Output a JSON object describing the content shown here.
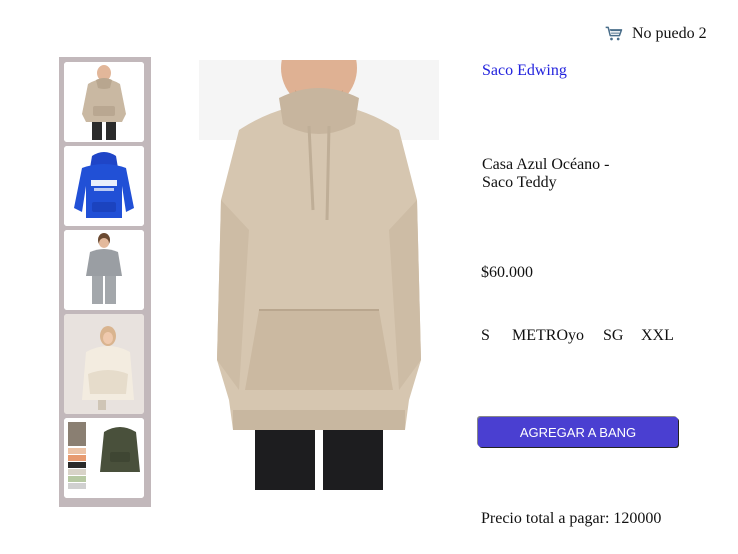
{
  "cart": {
    "icon": "cart-icon",
    "label": "No puedo 2"
  },
  "gallery": {
    "thumbnails": [
      {
        "name": "thumbnail-beige-hoodie"
      },
      {
        "name": "thumbnail-blue-hoodie"
      },
      {
        "name": "thumbnail-gray-sweatsuit"
      },
      {
        "name": "thumbnail-blanket-hoodie"
      },
      {
        "name": "thumbnail-hoodie-stack"
      }
    ],
    "main_image": "beige-hoodie-photo"
  },
  "product": {
    "link_title": "Saco Edwing",
    "description": "Casa Azul Océano - Saco Teddy",
    "price": "$60.000",
    "sizes": [
      "S",
      "METROyo",
      "SG",
      "XXL"
    ],
    "add_button": "AGREGAR A BANG",
    "total_label": "Precio total a pagar: 120000"
  },
  "colors": {
    "accent": "#4a3fd1",
    "link": "#2222dd",
    "thumb_bg": "#c2b8bb"
  }
}
